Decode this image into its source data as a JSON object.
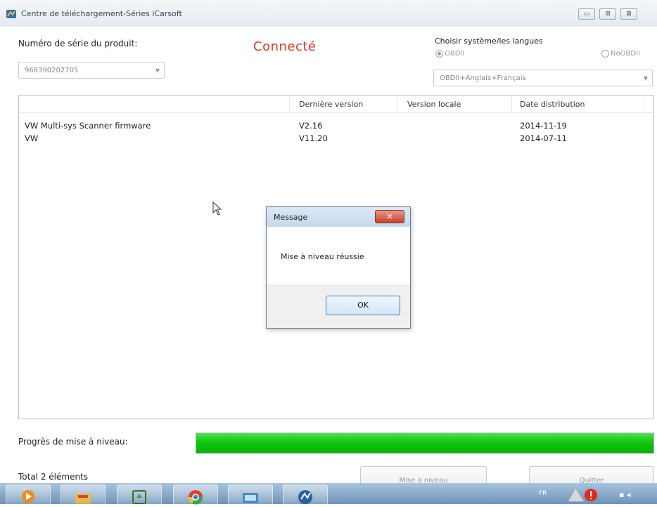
{
  "window": {
    "title": "Centre de téléchargement-Séries iCarsoft",
    "controls": {
      "minimize": "▭",
      "maximize": "⊞",
      "close": "⊠"
    }
  },
  "product": {
    "serial_label": "Numéro de série du produit:",
    "serial_value": "968390202705",
    "status": "Connecté"
  },
  "language": {
    "label": "Choisir système/les langues",
    "radio_obd": "OBDII",
    "radio_noobd": "NoOBDII",
    "selected": "OBDII+Anglais+Français"
  },
  "table": {
    "columns": [
      "",
      "Dernière version",
      "Version locale",
      "Date distribution"
    ],
    "rows": [
      {
        "name": "VW Multi-sys Scanner firmware",
        "latest": "V2.16",
        "local": "",
        "date": "2014-11-19"
      },
      {
        "name": "VW",
        "latest": "V11.20",
        "local": "",
        "date": "2014-07-11"
      }
    ]
  },
  "dialog": {
    "title": "Message",
    "message": "Mise à niveau réussie",
    "ok_label": "OK"
  },
  "progress": {
    "label": "Progrès de mise à niveau:",
    "value": 1.0
  },
  "footer": {
    "total": "Total 2 éléments",
    "upgrade_label": "Mise à niveau",
    "quit_label": "Quitter"
  },
  "taskbar": {
    "language_indicator": "FR",
    "items": [
      "media-player-icon",
      "folder-icon",
      "recycle-icon",
      "chrome-icon",
      "network-icon",
      "icarsoft-icon"
    ]
  },
  "colors": {
    "status": "#d23a2a",
    "progress": "#0cc40c"
  }
}
